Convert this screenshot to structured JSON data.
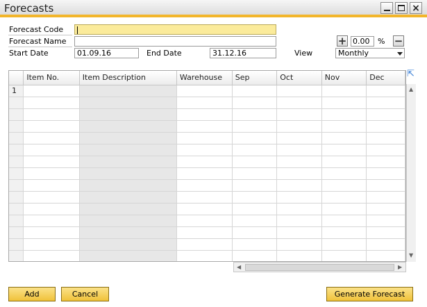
{
  "window": {
    "title": "Forecasts"
  },
  "header": {
    "forecast_code_label": "Forecast Code",
    "forecast_code_value": "",
    "forecast_name_label": "Forecast Name",
    "forecast_name_value": "",
    "start_date_label": "Start Date",
    "start_date_value": "01.09.16",
    "end_date_label": "End Date",
    "end_date_value": "31.12.16",
    "percent_value": "0.00",
    "percent_symbol": "%",
    "view_label": "View",
    "view_value": "Monthly"
  },
  "grid": {
    "columns": [
      "",
      "Item No.",
      "Item Description",
      "Warehouse",
      "Sep",
      "Oct",
      "Nov",
      "Dec"
    ],
    "first_row_number": "1"
  },
  "buttons": {
    "add": "Add",
    "cancel": "Cancel",
    "generate": "Generate Forecast"
  },
  "icons": {
    "increase": "plus-icon",
    "decrease": "minus-icon",
    "expand": "expand-arrow-icon"
  },
  "colors": {
    "accent": "#f2b52a",
    "active_field": "#fbeb9b",
    "button": "#f0c23a"
  }
}
